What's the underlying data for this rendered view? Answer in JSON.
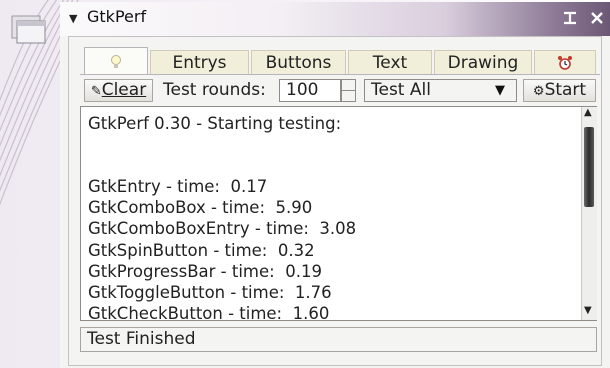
{
  "window": {
    "title": "GtkPerf"
  },
  "tabs": [
    {
      "label": "",
      "icon": "bulb-icon"
    },
    {
      "label": "Entrys"
    },
    {
      "label": "Buttons"
    },
    {
      "label": "Text"
    },
    {
      "label": "Drawing"
    },
    {
      "label": "",
      "icon": "alarm-clock-icon"
    }
  ],
  "toolbar": {
    "clear_label": "Clear",
    "rounds_label": "Test rounds:",
    "rounds_value": "100",
    "test_select_value": "Test All",
    "start_label": "Start"
  },
  "log": {
    "lines": [
      "GtkPerf 0.30 - Starting testing:",
      "",
      "",
      "GtkEntry - time:  0.17",
      "GtkComboBox - time:  5.90",
      "GtkComboBoxEntry - time:  3.08",
      "GtkSpinButton - time:  0.32",
      "GtkProgressBar - time:  0.19",
      "GtkToggleButton - time:  1.76",
      "GtkCheckButton - time:  1.60"
    ]
  },
  "status": {
    "text": "Test Finished"
  },
  "colors": {
    "titlebar_dark": "#6b5876",
    "tab_bg": "#f1efda",
    "window_bg": "#f4f4f2"
  }
}
